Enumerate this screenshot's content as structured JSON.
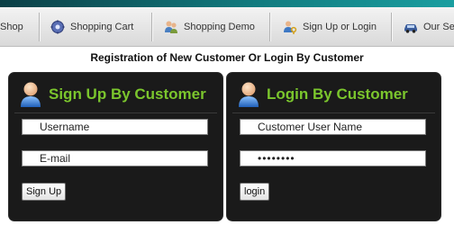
{
  "nav": {
    "items": [
      {
        "label": "Shop",
        "icon": "shop-icon"
      },
      {
        "label": "Shopping Cart",
        "icon": "cart-gear-icon"
      },
      {
        "label": "Shopping Demo",
        "icon": "users-icon"
      },
      {
        "label": "Sign Up or Login",
        "icon": "user-key-icon"
      },
      {
        "label": "Our Se",
        "icon": "car-icon"
      }
    ]
  },
  "page": {
    "heading": "Registration of New Customer Or Login By Customer"
  },
  "signup": {
    "title": "Sign Up By Customer",
    "username_value": "Username",
    "email_value": "E-mail",
    "submit_label": "Sign Up"
  },
  "login": {
    "title": "Login By Customer",
    "username_value": "Customer User Name",
    "password_value": "••••••••",
    "submit_label": "login"
  },
  "colors": {
    "accent_green": "#7bc62d",
    "panel_bg": "#1a1a1a",
    "topbar": "#127a7e"
  }
}
